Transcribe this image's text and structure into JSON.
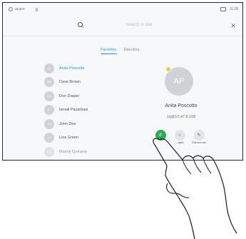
{
  "status_bar": {
    "system_name": "acano",
    "time": "11:28"
  },
  "search": {
    "placeholder": "Search or dial",
    "close_icon": "close-icon"
  },
  "tabs": [
    {
      "label": "Favorites",
      "active": true
    },
    {
      "label": "Directory",
      "active": false
    }
  ],
  "contacts": [
    {
      "name": "Anita Poscotto",
      "initials": "AP",
      "selected": true
    },
    {
      "name": "Dave Brown",
      "initials": "DB"
    },
    {
      "name": "Don Draper",
      "initials": "DD"
    },
    {
      "name": "Ismail Pazarbasi",
      "initials": "IP"
    },
    {
      "name": "John Doe",
      "initials": "JD"
    },
    {
      "name": "Lisa Green",
      "initials": "LG"
    },
    {
      "name": "Manny Quinana",
      "initials": "MQ"
    }
  ],
  "detail": {
    "initials": "AP",
    "name": "Anita Poscotto",
    "uri": "1q@10.47.8.108",
    "actions": [
      {
        "icon": "phone-icon",
        "label": ""
      },
      {
        "icon": "star-icon",
        "label": "...ages"
      },
      {
        "icon": "pencil-icon",
        "label": "Edit and call"
      }
    ]
  },
  "colors": {
    "accent": "#1e9fd6",
    "call_green": "#2ba94e",
    "favorite_yellow": "#f2c94c"
  }
}
